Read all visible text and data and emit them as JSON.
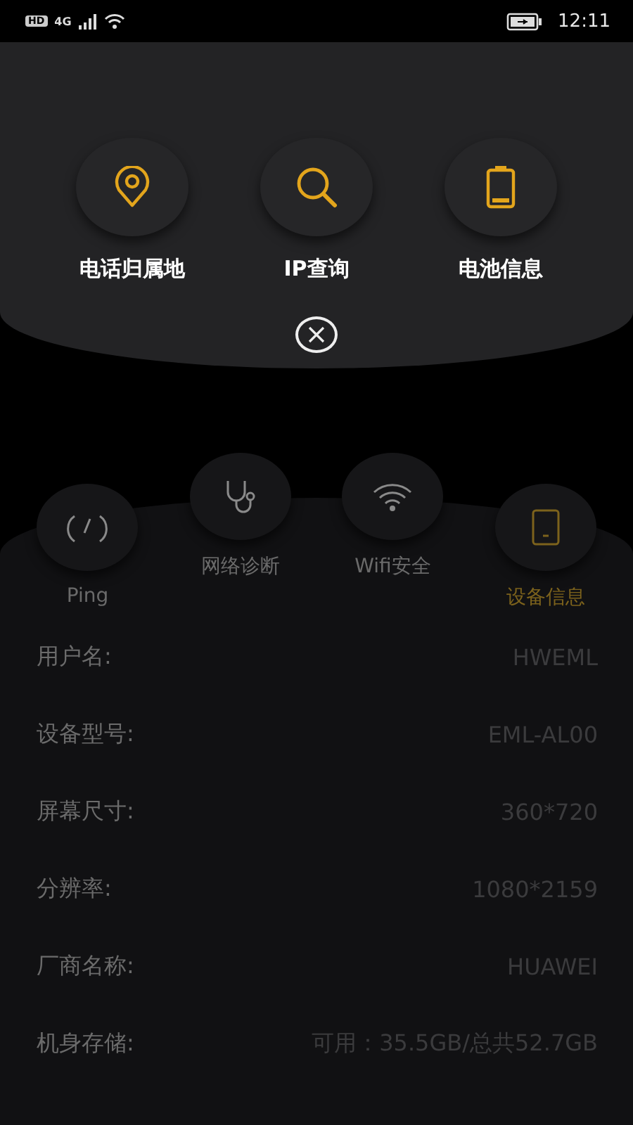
{
  "status_bar": {
    "badges": [
      "HD",
      "4G"
    ],
    "time": "12:11"
  },
  "quick_tools": [
    {
      "kind": "location",
      "label": "电话归属地"
    },
    {
      "kind": "search",
      "label": "IP查询"
    },
    {
      "kind": "battery",
      "label": "电池信息"
    }
  ],
  "tools": [
    {
      "kind": "ping",
      "label": "Ping",
      "selected": false
    },
    {
      "kind": "diagnose",
      "label": "网络诊断",
      "selected": false
    },
    {
      "kind": "wifi",
      "label": "Wifi安全",
      "selected": false
    },
    {
      "kind": "device",
      "label": "设备信息",
      "selected": true
    }
  ],
  "device_info": [
    {
      "label": "用户名:",
      "value": "HWEML"
    },
    {
      "label": "设备型号:",
      "value": "EML-AL00"
    },
    {
      "label": "屏幕尺寸:",
      "value": "360*720"
    },
    {
      "label": "分辨率:",
      "value": "1080*2159"
    },
    {
      "label": "厂商名称:",
      "value": "HUAWEI"
    },
    {
      "label": "机身存储:",
      "value": "可用：35.5GB/总共52.7GB"
    }
  ]
}
